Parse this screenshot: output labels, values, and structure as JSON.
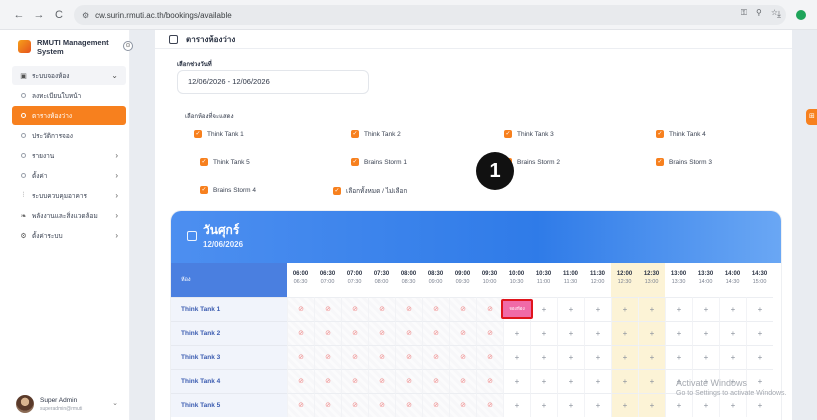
{
  "browser": {
    "url": "cw.surin.rmuti.ac.th/bookings/available",
    "nav_back": "←",
    "nav_forward": "→",
    "nav_reload": "C",
    "icons": [
      "key-icon",
      "zoom-icon",
      "star-icon",
      "download-icon",
      "extension-icon"
    ]
  },
  "sidebar": {
    "brand": "RMUTI Management System",
    "collapse_icon": "⊙",
    "group": {
      "label": "ระบบจองห้อง",
      "chevron": "⌄"
    },
    "items": [
      {
        "label": "ลงทะเบียนใบหน้า",
        "chevron": ""
      },
      {
        "label": "ตารางห้องว่าง",
        "chevron": "",
        "active": true
      },
      {
        "label": "ประวัติการจอง",
        "chevron": ""
      },
      {
        "label": "รายงาน",
        "chevron": "›"
      },
      {
        "label": "ตั้งค่า",
        "chevron": "›"
      }
    ],
    "sections": [
      {
        "label": "ระบบควบคุมอาคาร",
        "chevron": "›",
        "icon": "sliders-icon"
      },
      {
        "label": "พลังงานและสิ่งแวดล้อม",
        "chevron": "›",
        "icon": "leaf-icon"
      },
      {
        "label": "ตั้งค่าระบบ",
        "chevron": "›",
        "icon": "gear-icon"
      }
    ],
    "user": {
      "name": "Super Admin",
      "email": "superadmin@rmuti",
      "chevron": "⌄"
    }
  },
  "main": {
    "title": "ตารางห้องว่าง",
    "date_label": "เลือกช่วงวันที่",
    "date_value": "12/06/2026 - 12/06/2026",
    "rooms_label": "เลือกห้องที่จะแสดง",
    "checkboxes": [
      "Think Tank 1",
      "Think Tank 2",
      "Think Tank 3",
      "Think Tank 4",
      "Think Tank 5",
      "Brains Storm 1",
      "Brains Storm 2",
      "Brains Storm 3",
      "Brains Storm 4",
      "เลือกทั้งหมด / ไม่เลือก"
    ],
    "check_mark": "✓"
  },
  "schedule": {
    "day": "วันศุกร์",
    "date": "12/06/2026",
    "room_header": "ห้อง",
    "times": [
      [
        "06:00",
        "06:30"
      ],
      [
        "06:30",
        "07:00"
      ],
      [
        "07:00",
        "07:30"
      ],
      [
        "07:30",
        "08:00"
      ],
      [
        "08:00",
        "08:30"
      ],
      [
        "08:30",
        "09:00"
      ],
      [
        "09:00",
        "09:30"
      ],
      [
        "09:30",
        "10:00"
      ],
      [
        "10:00",
        "10:30"
      ],
      [
        "10:30",
        "11:00"
      ],
      [
        "11:00",
        "11:30"
      ],
      [
        "11:30",
        "12:00"
      ],
      [
        "12:00",
        "12:30"
      ],
      [
        "12:30",
        "13:00"
      ],
      [
        "13:00",
        "13:30"
      ],
      [
        "13:30",
        "14:00"
      ],
      [
        "14:00",
        "14:30"
      ],
      [
        "14:30",
        "15:00"
      ]
    ],
    "highlight_slots": [
      12,
      13
    ],
    "blocked_until_index": 8,
    "rooms": [
      "Think Tank 1",
      "Think Tank 2",
      "Think Tank 3",
      "Think Tank 4",
      "Think Tank 5"
    ],
    "blocked_symbol": "⊘",
    "free_symbol": "+",
    "booked": {
      "room_index": 0,
      "slot_index": 8,
      "label": "จองห้อง"
    }
  },
  "marker": "1",
  "side_button": "⊞",
  "watermark": {
    "line1": "Activate Windows",
    "line2": "Go to Settings to activate Windows."
  }
}
